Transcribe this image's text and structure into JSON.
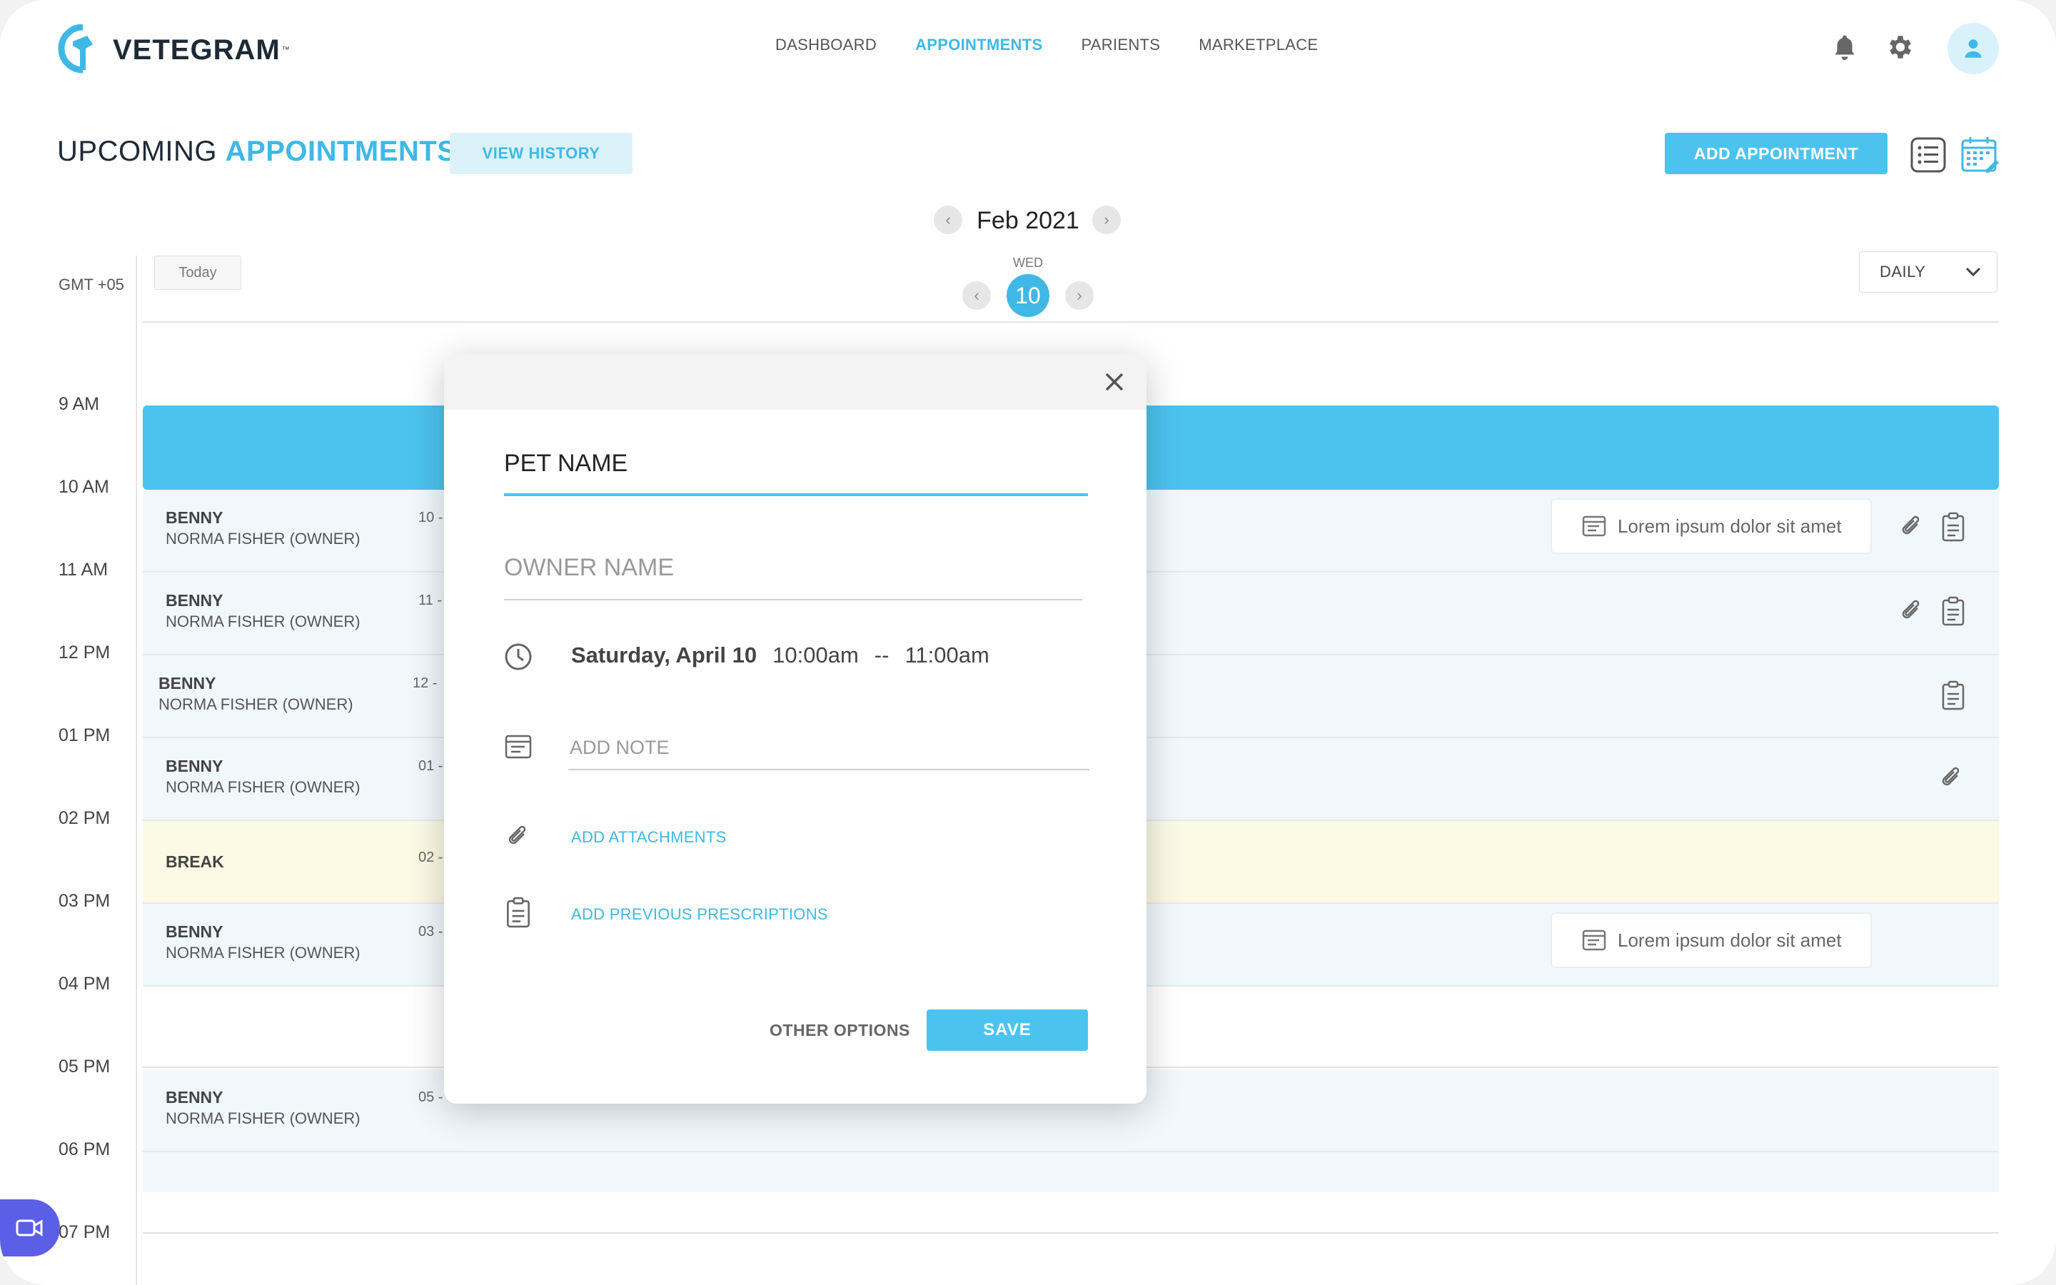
{
  "brand": {
    "name": "VETEGRAM",
    "tm": "™",
    "color": "#3fb8e6"
  },
  "nav": [
    "DASHBOARD",
    "APPOINTMENTS",
    "PARIENTS",
    "MARKETPLACE"
  ],
  "nav_active": "APPOINTMENTS",
  "header_icons": [
    "bell-icon",
    "gear-icon",
    "user-icon"
  ],
  "page": {
    "title_prefix": "UPCOMING",
    "title_highlight": "APPOINTMENTS",
    "view_history": "VIEW HISTORY",
    "add_appointment": "ADD APPOINTMENT"
  },
  "calendar": {
    "month": "Feb 2021",
    "timezone": "GMT +05",
    "today": "Today",
    "day_of_week": "WED",
    "day": "10",
    "view_mode": "DAILY",
    "hours": [
      "9 AM",
      "10 AM",
      "11 AM",
      "12 PM",
      "01 PM",
      "02 PM",
      "03 PM",
      "04 PM",
      "05 PM",
      "06 PM",
      "07 PM"
    ],
    "appointments": [
      {
        "pet": "BENNY",
        "owner": "NORMA FISHER (OWNER)",
        "time": "10 -",
        "note": "Lorem ipsum dolor sit amet"
      },
      {
        "pet": "BENNY",
        "owner": "NORMA FISHER (OWNER)",
        "time": "11 -"
      },
      {
        "pet": "BENNY",
        "owner": "NORMA FISHER (OWNER)",
        "time": "12 -"
      },
      {
        "pet": "BENNY",
        "owner": "NORMA FISHER (OWNER)",
        "time": "01 -"
      },
      {
        "pet": "BREAK",
        "owner": "",
        "time": "02 -"
      },
      {
        "pet": "BENNY",
        "owner": "NORMA FISHER (OWNER)",
        "time": "03 -",
        "note": "Lorem ipsum dolor sit amet"
      },
      {
        "pet": "BENNY",
        "owner": "NORMA FISHER (OWNER)",
        "time": "05 -"
      }
    ]
  },
  "modal": {
    "pet_name": "PET NAME",
    "owner_placeholder": "OWNER NAME",
    "date": "Saturday, April 10",
    "start": "10:00am",
    "separator": "--",
    "end": "11:00am",
    "note_placeholder": "ADD NOTE",
    "add_attachments": "ADD ATTACHMENTS",
    "add_prescriptions": "ADD PREVIOUS PRESCRIPTIONS",
    "other_options": "OTHER OPTIONS",
    "save": "SAVE"
  }
}
